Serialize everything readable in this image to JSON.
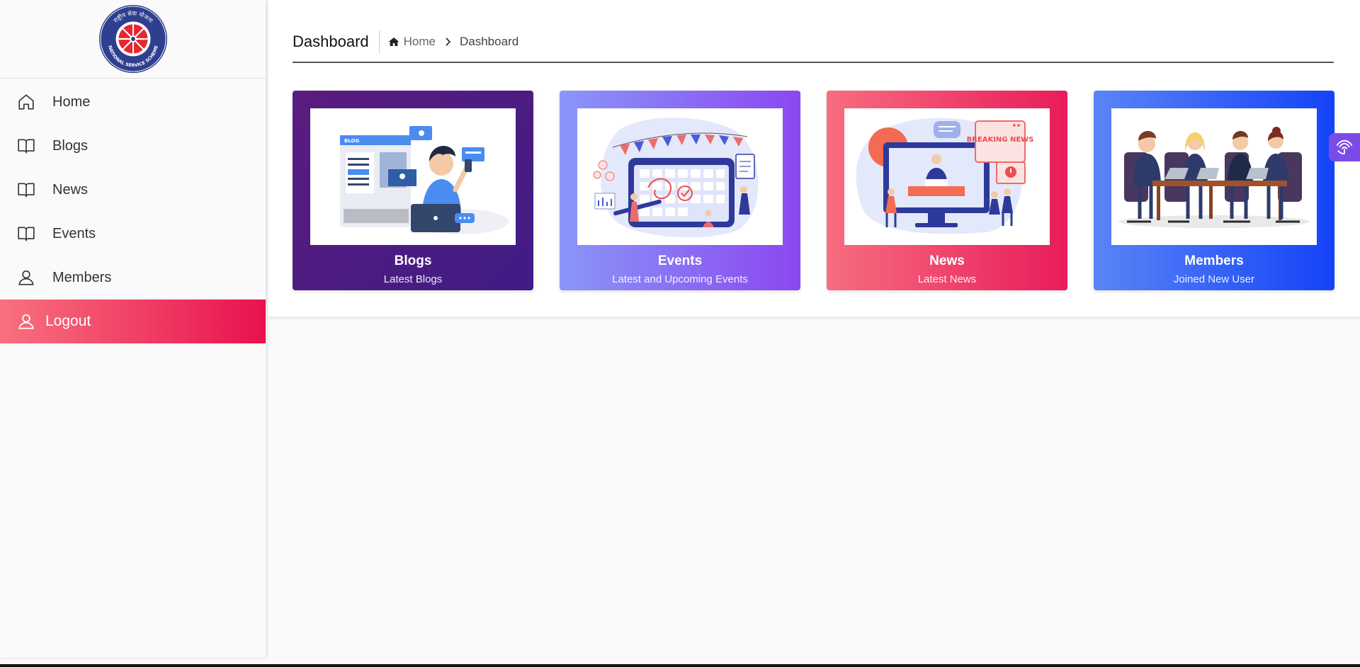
{
  "sidebar": {
    "logo": {
      "icon": "nss-emblem",
      "top_text": "राष्ट्रीय सेवा योजना",
      "bottom_text": "NATIONAL SERVICE SCHEME"
    },
    "items": [
      {
        "label": "Home",
        "icon": "home-icon"
      },
      {
        "label": "Blogs",
        "icon": "book-icon"
      },
      {
        "label": "News",
        "icon": "book-icon"
      },
      {
        "label": "Events",
        "icon": "book-icon"
      },
      {
        "label": "Members",
        "icon": "user-icon"
      },
      {
        "label": "Logout",
        "icon": "user-icon",
        "active": true
      }
    ]
  },
  "header": {
    "title": "Dashboard",
    "breadcrumb": {
      "home": "Home",
      "current": "Dashboard"
    }
  },
  "cards": [
    {
      "title": "Blogs",
      "subtitle": "Latest Blogs",
      "illustration": "blog-illustration",
      "illustration_text": "BLOG"
    },
    {
      "title": "Events",
      "subtitle": "Latest and Upcoming Events",
      "illustration": "calendar-illustration"
    },
    {
      "title": "News",
      "subtitle": "Latest News",
      "illustration": "breaking-news-illustration",
      "illustration_text": "BREAKING NEWS"
    },
    {
      "title": "Members",
      "subtitle": "Joined New User",
      "illustration": "team-meeting-illustration"
    }
  ],
  "floating_tab": {
    "icon": "accessibility-icon"
  },
  "colors": {
    "logout_active_start": "#f8717f",
    "logout_active_end": "#e8124e",
    "blogs_card": "#4a1c82",
    "events_card": "#8b6ef4",
    "news_card": "#ef3f6c",
    "members_card": "#3363f7"
  }
}
